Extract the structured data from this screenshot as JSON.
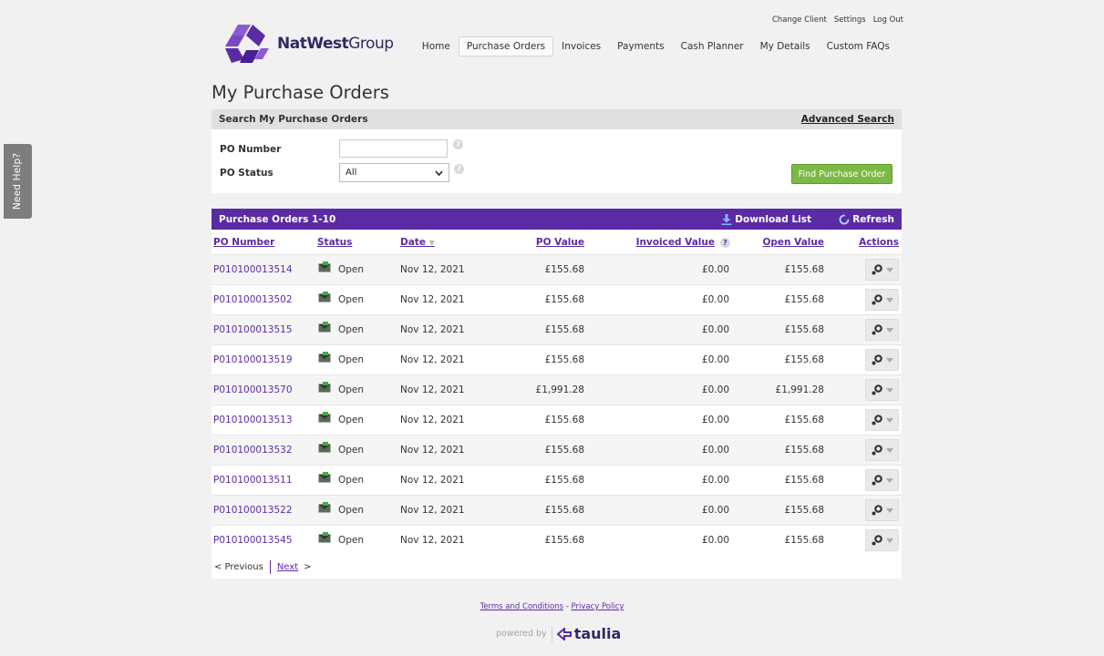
{
  "side": {
    "need_help": "Need Help?"
  },
  "top_links": [
    "Change Client",
    "Settings",
    "Log Out"
  ],
  "brand": {
    "name_bold": "NatWest",
    "name_rest": "Group",
    "logo_color": "#5b2ba5"
  },
  "nav": [
    "Home",
    "Purchase Orders",
    "Invoices",
    "Payments",
    "Cash Planner",
    "My Details",
    "Custom FAQs"
  ],
  "page_title": "My Purchase Orders",
  "search": {
    "title": "Search My Purchase Orders",
    "advanced": "Advanced Search",
    "po_number_label": "PO Number",
    "po_number_value": "",
    "po_status_label": "PO Status",
    "po_status_value": "All",
    "find_button": "Find Purchase Order"
  },
  "results": {
    "title": "Purchase Orders 1-10",
    "download": "Download List",
    "refresh": "Refresh",
    "columns": {
      "po_number": "PO Number",
      "status": "Status",
      "date": "Date",
      "po_value": "PO Value",
      "invoiced_value": "Invoiced Value",
      "open_value": "Open Value",
      "actions": "Actions"
    },
    "rows": [
      {
        "po": "P010100013514",
        "status": "Open",
        "date": "Nov 12, 2021",
        "po_value": "£155.68",
        "invoiced": "£0.00",
        "open": "£155.68"
      },
      {
        "po": "P010100013502",
        "status": "Open",
        "date": "Nov 12, 2021",
        "po_value": "£155.68",
        "invoiced": "£0.00",
        "open": "£155.68"
      },
      {
        "po": "P010100013515",
        "status": "Open",
        "date": "Nov 12, 2021",
        "po_value": "£155.68",
        "invoiced": "£0.00",
        "open": "£155.68"
      },
      {
        "po": "P010100013519",
        "status": "Open",
        "date": "Nov 12, 2021",
        "po_value": "£155.68",
        "invoiced": "£0.00",
        "open": "£155.68"
      },
      {
        "po": "P010100013570",
        "status": "Open",
        "date": "Nov 12, 2021",
        "po_value": "£1,991.28",
        "invoiced": "£0.00",
        "open": "£1,991.28"
      },
      {
        "po": "P010100013513",
        "status": "Open",
        "date": "Nov 12, 2021",
        "po_value": "£155.68",
        "invoiced": "£0.00",
        "open": "£155.68"
      },
      {
        "po": "P010100013532",
        "status": "Open",
        "date": "Nov 12, 2021",
        "po_value": "£155.68",
        "invoiced": "£0.00",
        "open": "£155.68"
      },
      {
        "po": "P010100013511",
        "status": "Open",
        "date": "Nov 12, 2021",
        "po_value": "£155.68",
        "invoiced": "£0.00",
        "open": "£155.68"
      },
      {
        "po": "P010100013522",
        "status": "Open",
        "date": "Nov 12, 2021",
        "po_value": "£155.68",
        "invoiced": "£0.00",
        "open": "£155.68"
      },
      {
        "po": "P010100013545",
        "status": "Open",
        "date": "Nov 12, 2021",
        "po_value": "£155.68",
        "invoiced": "£0.00",
        "open": "£155.68"
      }
    ],
    "pager": {
      "previous": "< Previous",
      "next": "Next",
      "next_arrow": ">"
    }
  },
  "footer": {
    "terms": "Terms and Conditions",
    "separator": "-",
    "privacy": "Privacy Policy",
    "powered_by": "powered by",
    "vendor": "taulia"
  }
}
